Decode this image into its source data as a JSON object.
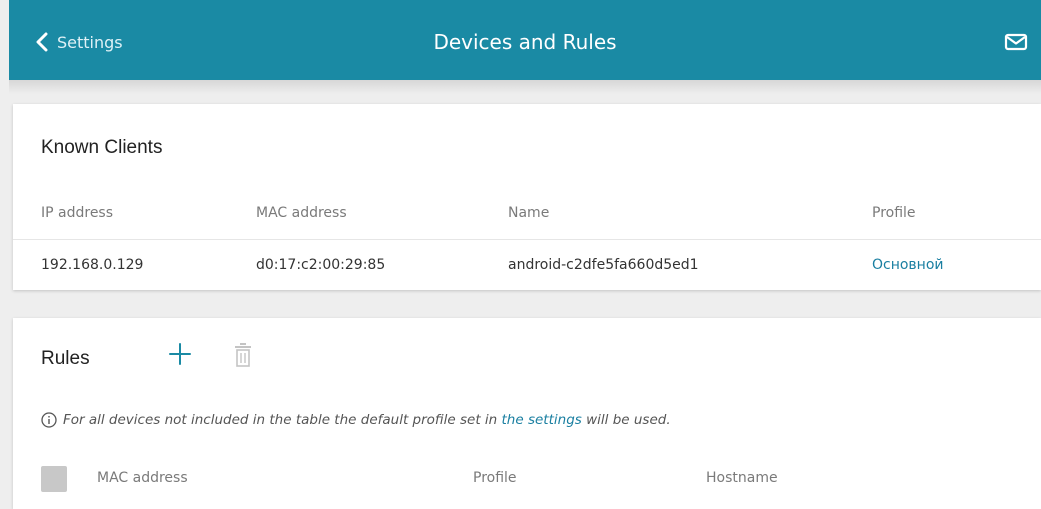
{
  "header": {
    "back_label": "Settings",
    "title": "Devices and Rules",
    "accent_color": "#1a8aa4"
  },
  "known_clients": {
    "title": "Known Clients",
    "columns": [
      "IP address",
      "MAC address",
      "Name",
      "Profile"
    ],
    "rows": [
      {
        "ip": "192.168.0.129",
        "mac": "d0:17:c2:00:29:85",
        "name": "android-c2dfe5fa660d5ed1",
        "profile": "Основной"
      }
    ]
  },
  "rules": {
    "title": "Rules",
    "note_prefix": "For all devices not included in the table the default profile set in ",
    "note_link": "the settings",
    "note_suffix": " will be used.",
    "columns": [
      "MAC address",
      "Profile",
      "Hostname"
    ]
  },
  "icons": {
    "back": "chevron-left-icon",
    "mail": "mail-icon",
    "add": "plus-icon",
    "delete": "trash-icon",
    "info": "info-icon"
  }
}
